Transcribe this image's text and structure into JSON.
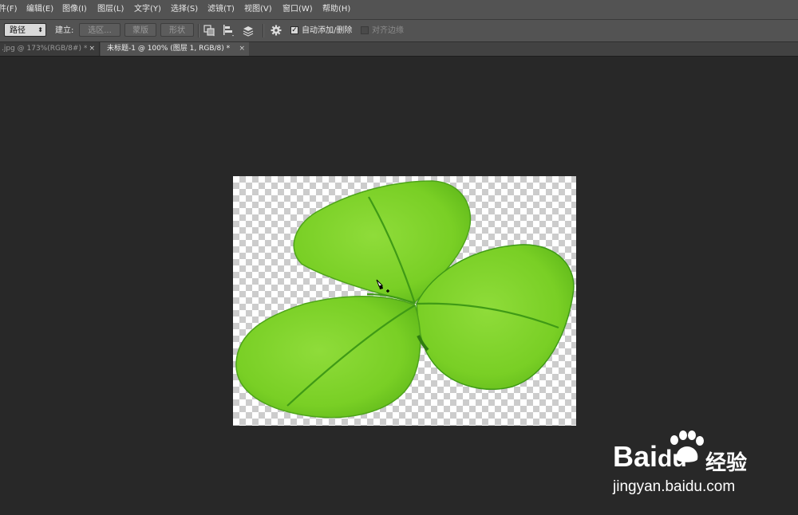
{
  "menu": {
    "items": [
      "件(F)",
      "编辑(E)",
      "图像(I)",
      "图层(L)",
      "文字(Y)",
      "选择(S)",
      "滤镜(T)",
      "视图(V)",
      "窗口(W)",
      "帮助(H)"
    ]
  },
  "options": {
    "mode_select": "路径",
    "make_label": "建立:",
    "selection_button": "选区...",
    "mask_button": "蒙版",
    "shape_button": "形状",
    "auto_add_delete_label": "自动添加/删除",
    "auto_add_delete_checked": true,
    "align_edges_label": "对齐边缘",
    "align_edges_checked": false
  },
  "tabs": [
    {
      "label": ".jpg @ 173%(RGB/8#) *",
      "close": "×",
      "active": false
    },
    {
      "label": "未标题-1 @ 100% (图层 1, RGB/8) *",
      "close": "×",
      "active": true
    }
  ],
  "canvas": {
    "content": "four-leaf-clover-icon",
    "leaf_color": "#7ed321",
    "vein_color": "#3f9a16",
    "cursor": "pen-add-cursor-icon"
  },
  "watermark": {
    "brand": "Bai",
    "brand_suffix": "du",
    "cn": "经验",
    "url": "jingyan.baidu.com"
  }
}
